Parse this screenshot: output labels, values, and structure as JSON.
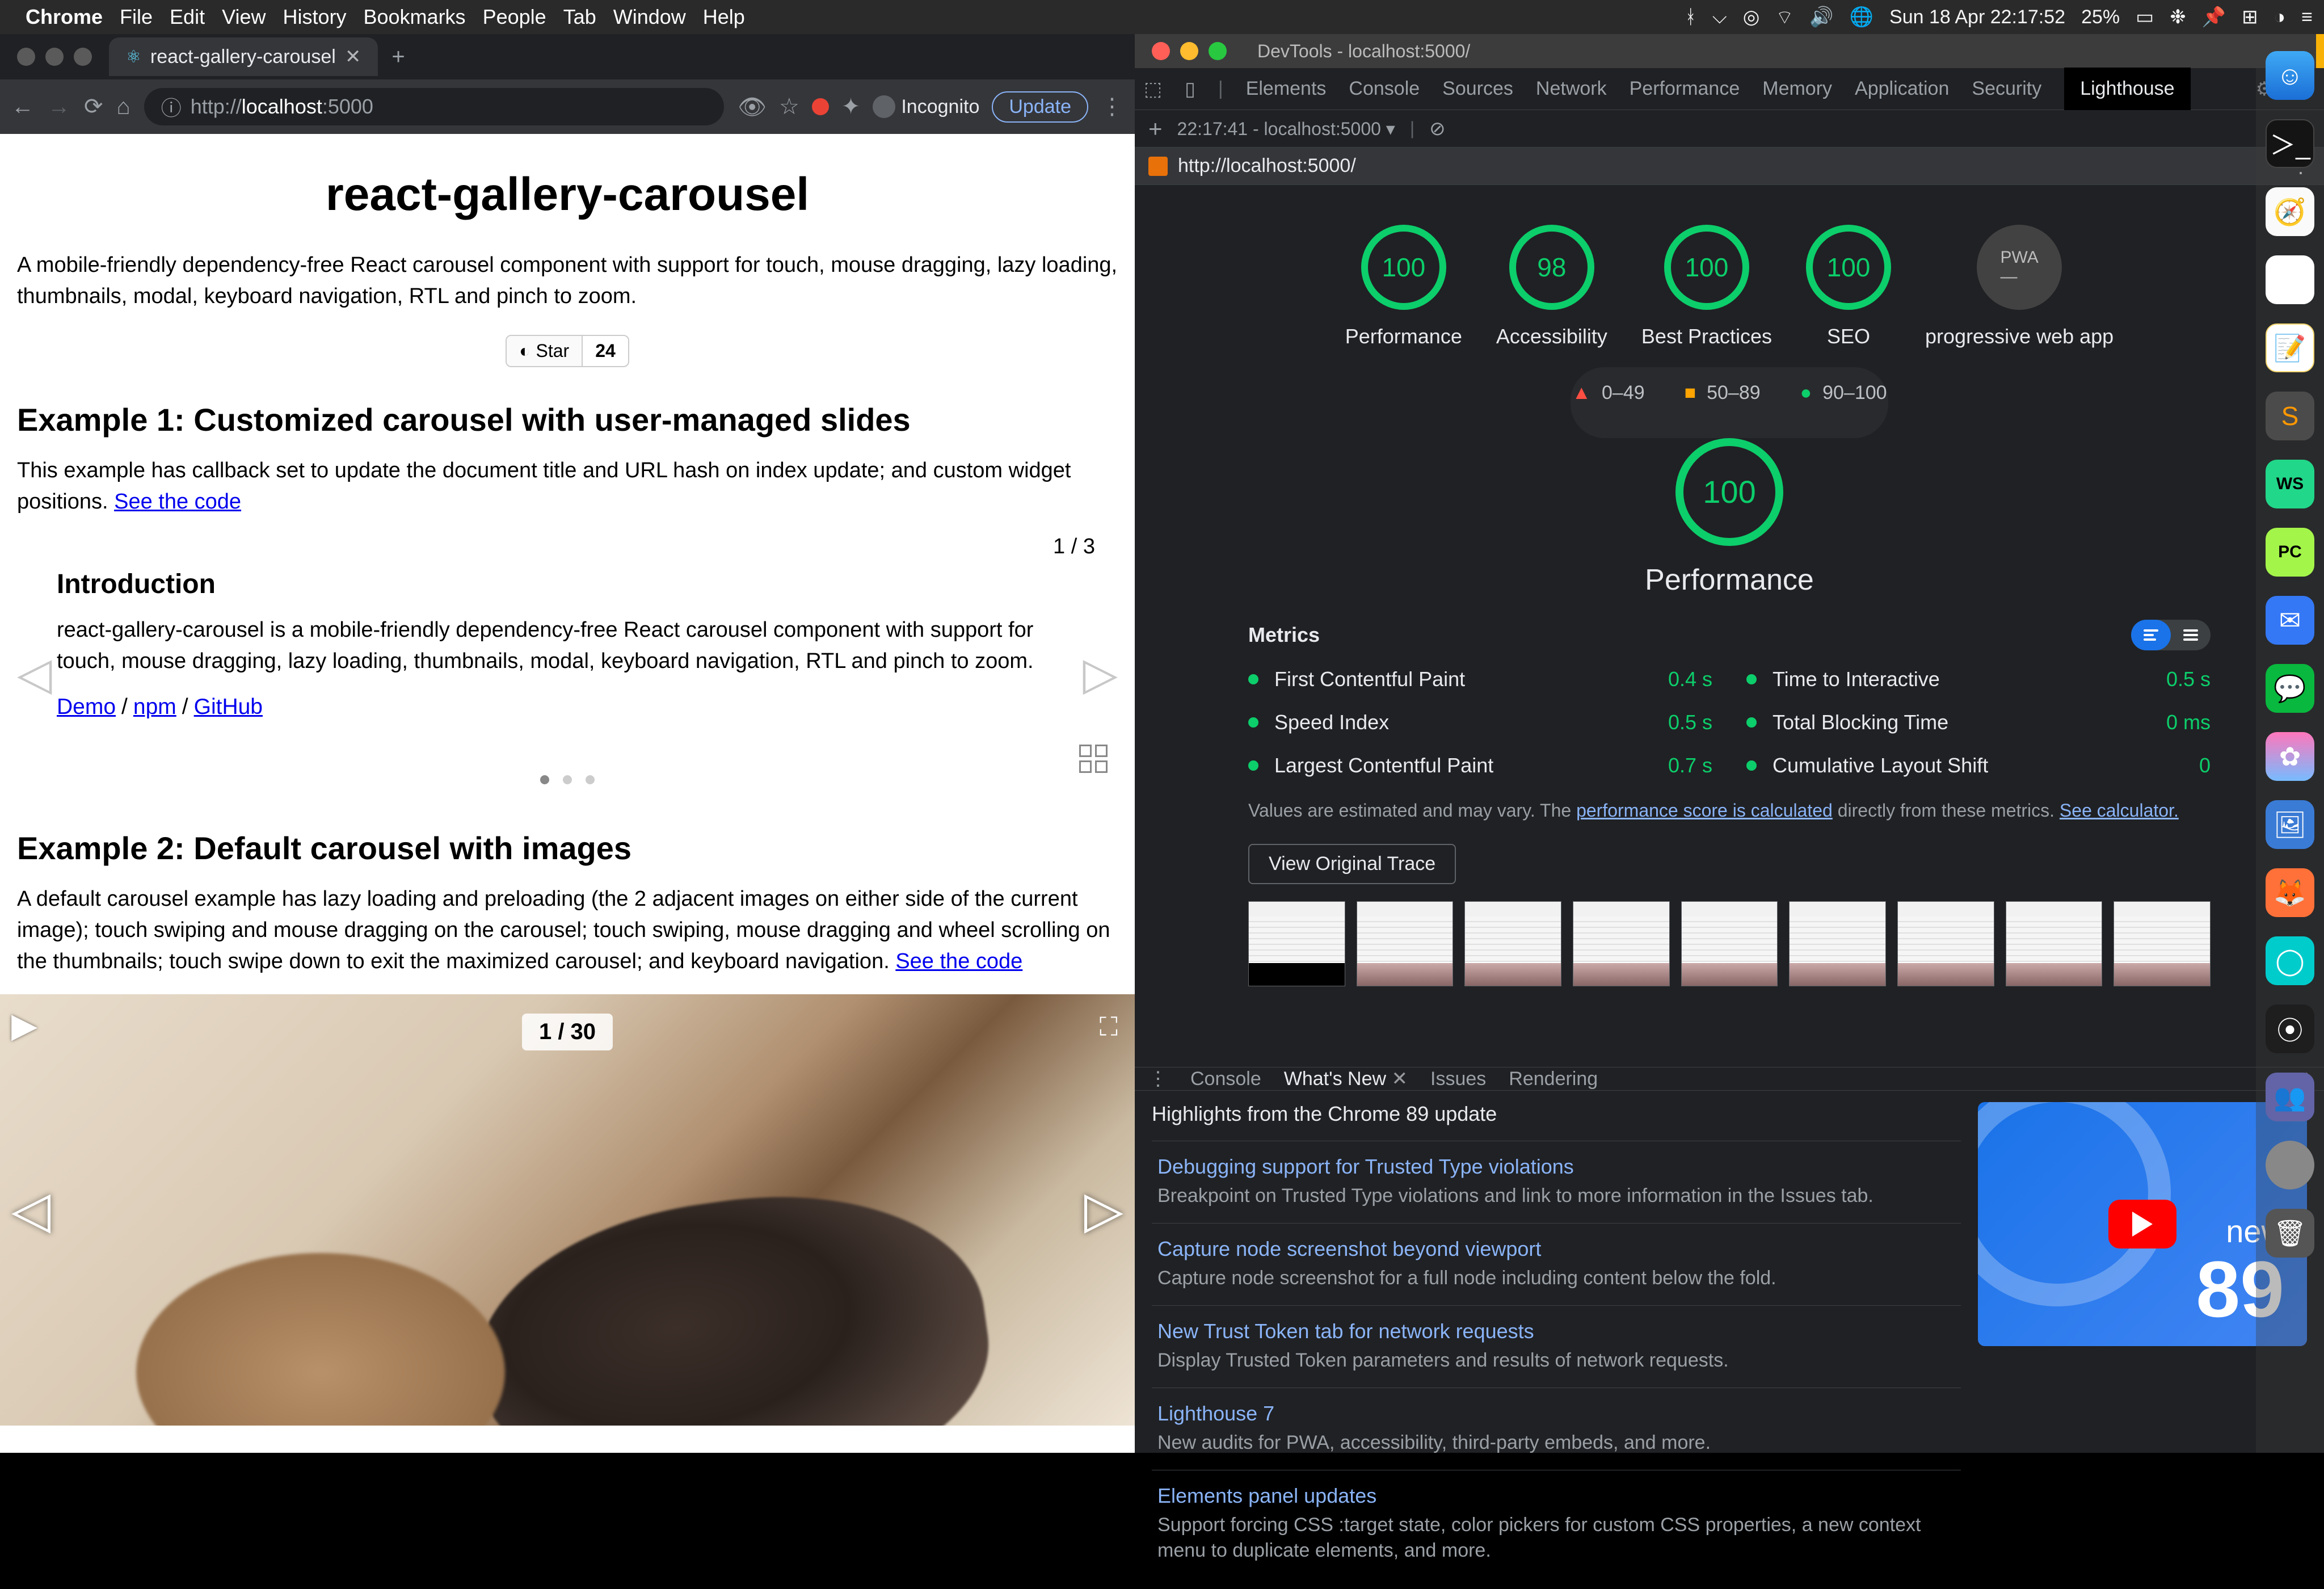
{
  "menubar": {
    "app": "Chrome",
    "items": [
      "File",
      "Edit",
      "View",
      "History",
      "Bookmarks",
      "People",
      "Tab",
      "Window",
      "Help"
    ],
    "clock": "Sun 18 Apr  22:17:52",
    "battery": "25%"
  },
  "chrome": {
    "tab_title": "react-gallery-carousel",
    "url_prefix": "http://",
    "url_host": "localhost",
    "url_port": ":5000",
    "incognito": "Incognito",
    "update": "Update"
  },
  "page": {
    "title": "react-gallery-carousel",
    "subtitle": "A mobile-friendly dependency-free React carousel component with support for touch, mouse dragging, lazy loading, thumbnails, modal, keyboard navigation, RTL and pinch to zoom.",
    "gh_star": "Star",
    "gh_count": "24",
    "ex1_title": "Example 1: Customized carousel with user-managed slides",
    "ex1_text_a": "This example has callback set to update the document title and URL hash on index update; and custom widget positions. ",
    "ex1_link": "See the code",
    "slide1_counter": "1 / 3",
    "slide1_h": "Introduction",
    "slide1_body": "react-gallery-carousel is a mobile-friendly dependency-free React carousel component with support for touch, mouse dragging, lazy loading, thumbnails, modal, keyboard navigation, RTL and pinch to zoom.",
    "slide1_links": {
      "demo": "Demo",
      "npm": "npm",
      "github": "GitHub"
    },
    "ex2_title": "Example 2: Default carousel with images",
    "ex2_text_a": "A default carousel example has lazy loading and preloading (the 2 adjacent images on either side of the current image); touch swiping and mouse dragging on the carousel; touch swiping, mouse dragging and wheel scrolling on the thumbnails; touch swipe down to exit the maximized carousel; and keyboard navigation. ",
    "ex2_link": "See the code",
    "slide2_counter": "1 / 30"
  },
  "devtools": {
    "window_title": "DevTools - localhost:5000/",
    "tabs": [
      "Elements",
      "Console",
      "Sources",
      "Network",
      "Performance",
      "Memory",
      "Application",
      "Security",
      "Lighthouse"
    ],
    "lh_run": "22:17:41 - localhost:5000",
    "lh_url": "http://localhost:5000/",
    "gauges": [
      {
        "score": "100",
        "label": "Performance"
      },
      {
        "score": "98",
        "label": "Accessibility"
      },
      {
        "score": "100",
        "label": "Best Practices"
      },
      {
        "score": "100",
        "label": "SEO"
      },
      {
        "score": "PWA",
        "label": "progressive web app",
        "pwa": true
      }
    ],
    "legend": {
      "a": "0–49",
      "b": "50–89",
      "c": "90–100"
    },
    "big_score": "100",
    "big_label": "Performance",
    "metrics_title": "Metrics",
    "metrics": [
      {
        "name": "First Contentful Paint",
        "value": "0.4 s"
      },
      {
        "name": "Time to Interactive",
        "value": "0.5 s"
      },
      {
        "name": "Speed Index",
        "value": "0.5 s"
      },
      {
        "name": "Total Blocking Time",
        "value": "0 ms"
      },
      {
        "name": "Largest Contentful Paint",
        "value": "0.7 s"
      },
      {
        "name": "Cumulative Layout Shift",
        "value": "0"
      }
    ],
    "metrics_note_a": "Values are estimated and may vary. The ",
    "metrics_note_link1": "performance score is calculated",
    "metrics_note_b": " directly from these metrics. ",
    "metrics_note_link2": "See calculator.",
    "view_trace": "View Original Trace"
  },
  "drawer": {
    "tabs": [
      "Console",
      "What's New",
      "Issues",
      "Rendering"
    ],
    "heading": "Highlights from the Chrome 89 update",
    "news": [
      {
        "t": "Debugging support for Trusted Type violations",
        "d": "Breakpoint on Trusted Type violations and link to more information in the Issues tab."
      },
      {
        "t": "Capture node screenshot beyond viewport",
        "d": "Capture node screenshot for a full node including content below the fold."
      },
      {
        "t": "New Trust Token tab for network requests",
        "d": "Display Trusted Token parameters and results of network requests."
      },
      {
        "t": "Lighthouse 7",
        "d": "New audits for PWA, accessibility, third-party embeds, and more."
      },
      {
        "t": "Elements panel updates",
        "d": "Support forcing CSS :target state, color pickers for custom CSS properties, a new context menu to duplicate elements, and more."
      }
    ],
    "promo": {
      "new": "new",
      "num": "89"
    }
  }
}
